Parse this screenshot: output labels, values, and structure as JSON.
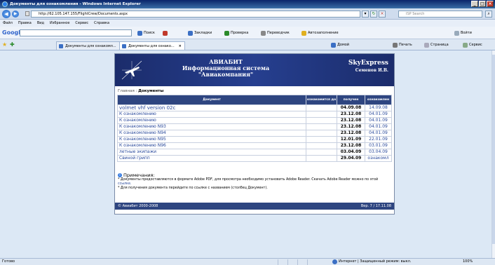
{
  "window": {
    "title": "Документы для ознакомления - Windows Internet Explorer"
  },
  "address_bar": {
    "url": "http://62.105.147.155/FlightCrew/Documents.aspx",
    "search_placeholder": "ISP Search"
  },
  "menu": [
    "Файл",
    "Правка",
    "Вид",
    "Избранное",
    "Сервис",
    "Справка"
  ],
  "google_toolbar": {
    "logo": "Google",
    "items": [
      "Поиск",
      "Закладки",
      "Проверка",
      "Переводчик",
      "Автозаполнение",
      "Войти"
    ]
  },
  "tabs": [
    {
      "label": "Документы для ознакомл..."
    },
    {
      "label": "Документы для ознако...",
      "active": true
    }
  ],
  "command_bar": [
    "Домой",
    "Печать",
    "Страница",
    "Сервис"
  ],
  "site": {
    "org": "АВИАБИТ",
    "system_line1": "Информационная система",
    "system_line2": "\"Авиакомпания\"",
    "company": "SkyExpress",
    "user": "Семенов И.В."
  },
  "breadcrumb": {
    "home": "Главная",
    "separator": " : ",
    "current": "Документы"
  },
  "table": {
    "headers": [
      "Документ",
      "ознакомится до",
      "получен",
      "ознакомлен"
    ],
    "rows": [
      {
        "doc": "volmet vhf version 02c",
        "deadline": "",
        "received": "04.09.08",
        "acknowledged": "14.09.08"
      },
      {
        "doc": "К ознакомлению",
        "deadline": "",
        "received": "23.12.08",
        "acknowledged": "04.01.09"
      },
      {
        "doc": "К ознакомлению",
        "deadline": "",
        "received": "23.12.08",
        "acknowledged": "04.01.09"
      },
      {
        "doc": "К ознакомлению N93",
        "deadline": "",
        "received": "23.12.08",
        "acknowledged": "04.01.09"
      },
      {
        "doc": "К ознакомлению N94",
        "deadline": "",
        "received": "23.12.08",
        "acknowledged": "04.01.09"
      },
      {
        "doc": "К ознакомлению N95",
        "deadline": "",
        "received": "12.01.09",
        "acknowledged": "22.01.09"
      },
      {
        "doc": "К ознакомлению N96",
        "deadline": "",
        "received": "23.12.08",
        "acknowledged": "03.01.09"
      },
      {
        "doc": "летные экипажи",
        "deadline": "",
        "received": "03.04.09",
        "acknowledged": "03.04.09"
      },
      {
        "doc": "Свиной грипп",
        "deadline": "",
        "received": "29.04.09",
        "acknowledged": "ознакомл"
      }
    ]
  },
  "notes": {
    "heading": "Примечания:",
    "line1": "* Документы предоставляются в формате Adobe PDF, для просмотра необходимо установить Adobe Reader. Скачать Adobe Reader можно по этой",
    "line1_link": "ссылке.",
    "line2": "* Для получения документа перейдите по ссылке с названием (столбец Документ)."
  },
  "footer": {
    "copyright": "© Авиабит 2000-2008",
    "version": "Вер. 7 / 17.11.08"
  },
  "status_bar": {
    "left": "Готово",
    "zone": "Интернет | Защищенный режим: выкл.",
    "zoom": "100%"
  },
  "colors": {
    "banner": "#1b2c6b",
    "table_header": "#2e4580",
    "link": "#2a4a9c"
  }
}
